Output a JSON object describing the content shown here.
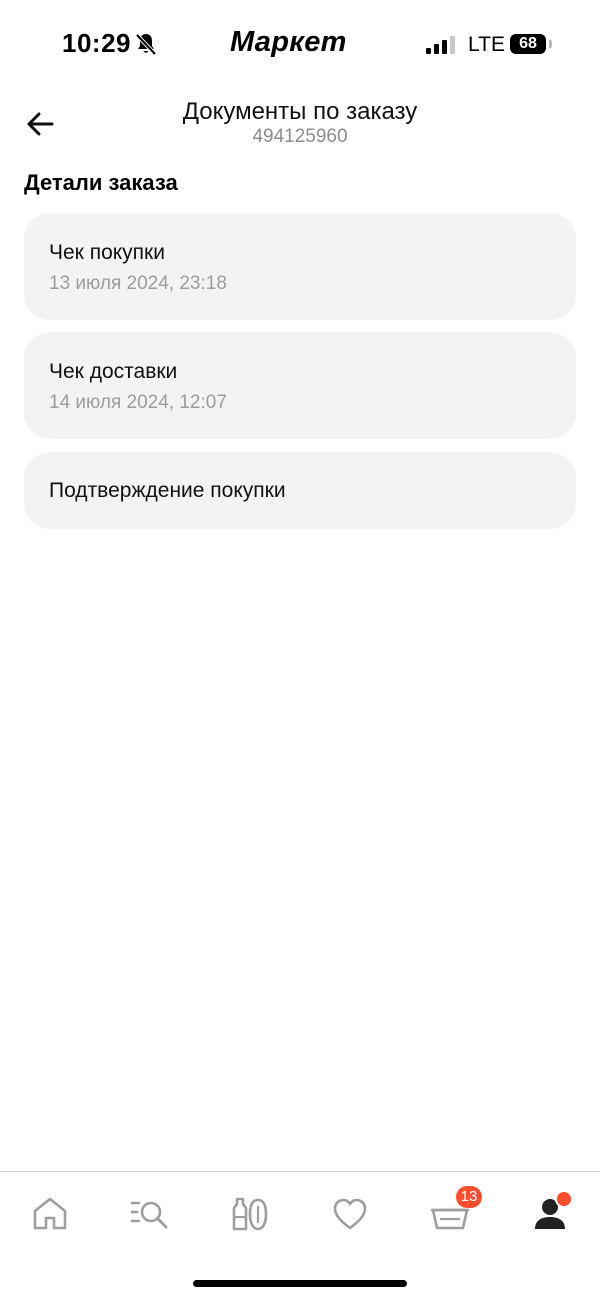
{
  "status_bar": {
    "time": "10:29",
    "brand": "Маркет",
    "network": "LTE",
    "battery": "68",
    "icons": [
      "bell-muted-icon",
      "signal-icon",
      "battery-icon"
    ]
  },
  "header": {
    "title": "Документы по заказу",
    "order_number": "494125960",
    "back_icon": "arrow-left-icon"
  },
  "section": {
    "title": "Детали заказа"
  },
  "documents": [
    {
      "title": "Чек покупки",
      "date": "13 июля 2024, 23:18"
    },
    {
      "title": "Чек доставки",
      "date": "14 июля 2024, 12:07"
    },
    {
      "title": "Подтверждение покупки"
    }
  ],
  "bottom_nav": {
    "items": [
      "home-icon",
      "catalog-search-icon",
      "products-icon",
      "heart-icon",
      "cart-icon",
      "profile-icon"
    ],
    "cart_count": "13",
    "colors": {
      "inactive": "#9e9e9e",
      "active": "#222222",
      "badge": "#ff4d2e"
    }
  },
  "colors": {
    "card_bg": "#f4f3f1",
    "secondary_text": "#9c9c9c"
  }
}
